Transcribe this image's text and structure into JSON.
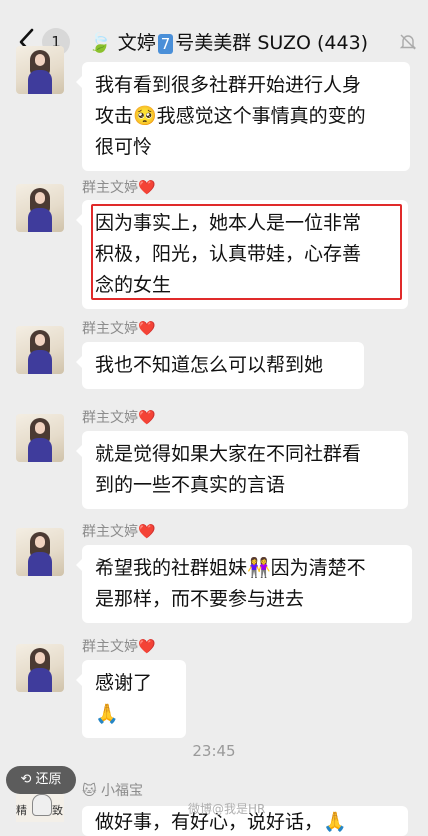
{
  "header": {
    "back_label": "返回",
    "unread_count": "1",
    "title_prefix": "文婷",
    "title_number": "7️⃣",
    "title_rest": "号美美群 SUZO",
    "member_count": "(443)"
  },
  "messages": [
    {
      "sender": "",
      "text_lines": [
        "我有看到很多社群开始进行人身",
        "攻击🥺我感觉这个事情真的变的",
        "很可怜"
      ]
    },
    {
      "sender": "群主文婷",
      "heart": "❤️",
      "text_lines": [
        "因为事实上，她本人是一位非常",
        "积极，阳光，认真带娃，心存善",
        "念的女生"
      ]
    },
    {
      "sender": "群主文婷",
      "heart": "❤️",
      "text_lines": [
        "我也不知道怎么可以帮到她"
      ]
    },
    {
      "sender": "群主文婷",
      "heart": "❤️",
      "text_lines": [
        "就是觉得如果大家在不同社群看",
        "到的一些不真实的言语"
      ]
    },
    {
      "sender": "群主文婷",
      "heart": "❤️",
      "text_lines": [
        "希望我的社群姐妹👭因为清楚不",
        "是那样，而不要参与进去"
      ]
    },
    {
      "sender": "群主文婷",
      "heart": "❤️",
      "text_lines": [
        "感谢了🙏"
      ]
    }
  ],
  "time_divider": "23:45",
  "restore_button": "还原",
  "next_sender": "🐱 小福宝",
  "next_avatar_text": [
    "精",
    "致"
  ],
  "watermark": "微博@我是HR",
  "next_message_partial": "做好事，有好心，说好话，🙏"
}
